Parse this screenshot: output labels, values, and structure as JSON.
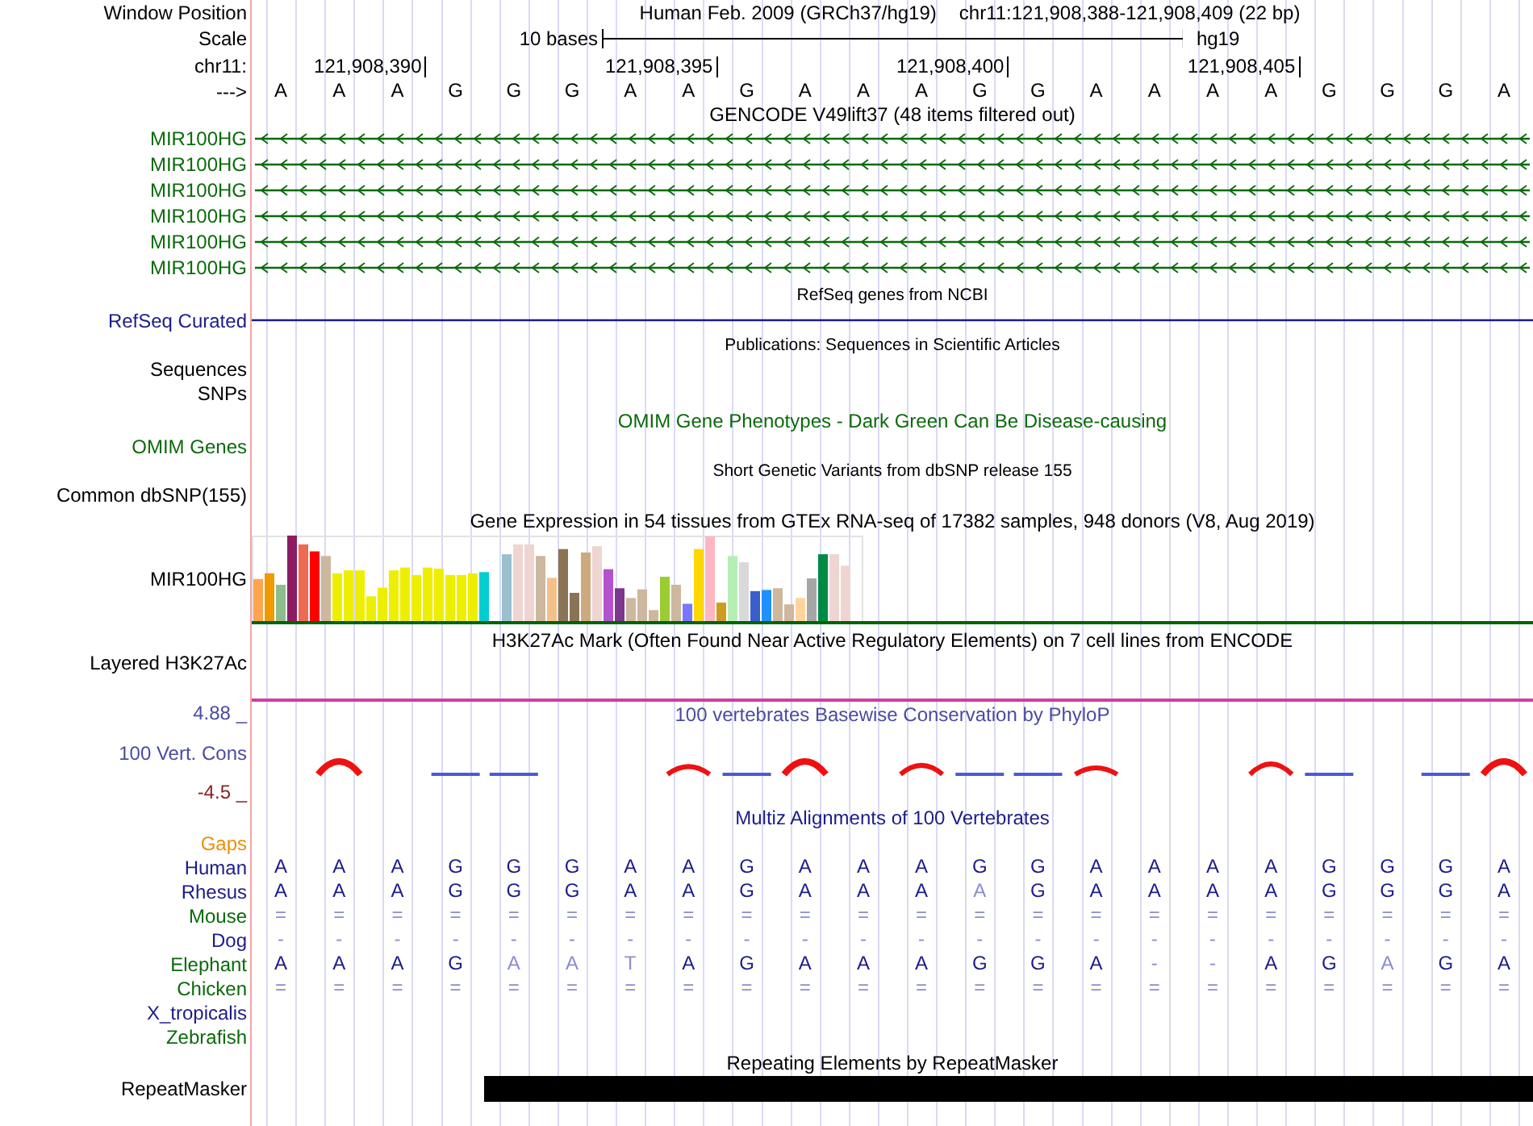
{
  "header": {
    "label": "Window Position",
    "assembly": "Human Feb. 2009 (GRCh37/hg19)",
    "range": "chr11:121,908,388-121,908,409 (22 bp)"
  },
  "scale": {
    "label": "Scale",
    "length": "10 bases",
    "assembly": "hg19"
  },
  "ruler": {
    "label": "chr11:",
    "ticks": [
      "121,908,390",
      "121,908,395",
      "121,908,400",
      "121,908,405"
    ]
  },
  "sequence": {
    "label": "--->",
    "bases": [
      "A",
      "A",
      "A",
      "G",
      "G",
      "G",
      "A",
      "A",
      "G",
      "A",
      "A",
      "A",
      "G",
      "G",
      "A",
      "A",
      "A",
      "A",
      "G",
      "G",
      "G",
      "A"
    ]
  },
  "gencode": {
    "title": "GENCODE V49lift37 (48 items filtered out)",
    "genes": [
      {
        "label": "MIR100HG"
      },
      {
        "label": "MIR100HG"
      },
      {
        "label": "MIR100HG"
      },
      {
        "label": "MIR100HG"
      },
      {
        "label": "MIR100HG"
      },
      {
        "label": "MIR100HG"
      }
    ]
  },
  "refseq": {
    "title": "RefSeq genes from NCBI",
    "label": "RefSeq Curated"
  },
  "publications": {
    "title": "Publications: Sequences in Scientific Articles",
    "label": "Sequences"
  },
  "snps": {
    "label": "SNPs"
  },
  "omim": {
    "title": "OMIM Gene Phenotypes - Dark Green Can Be Disease-causing",
    "label": "OMIM Genes"
  },
  "dbsnp": {
    "title": "Short Genetic Variants from dbSNP release 155",
    "label": "Common dbSNP(155)"
  },
  "gtex": {
    "title": "Gene Expression in 54 tissues from GTEx RNA-seq of 17382 samples, 948 donors (V8, Aug 2019)",
    "label": "MIR100HG"
  },
  "h3k27ac": {
    "title": "H3K27Ac Mark (Often Found Near Active Regulatory Elements) on 7 cell lines from ENCODE",
    "label": "Layered H3K27Ac"
  },
  "phylop": {
    "title": "100 vertebrates Basewise Conservation by PhyloP",
    "label": "100 Vert. Cons",
    "max": "4.88 _",
    "min": "-4.5 _"
  },
  "multiz": {
    "title": "Multiz Alignments of 100 Vertebrates",
    "gaps_label": "Gaps",
    "species": [
      {
        "label": "Human",
        "color": "#1c1c8a",
        "cells": [
          {
            "b": "A",
            "faded": false
          },
          {
            "b": "A",
            "faded": false
          },
          {
            "b": "A",
            "faded": false
          },
          {
            "b": "G",
            "faded": false
          },
          {
            "b": "G",
            "faded": false
          },
          {
            "b": "G",
            "faded": false
          },
          {
            "b": "A",
            "faded": false
          },
          {
            "b": "A",
            "faded": false
          },
          {
            "b": "G",
            "faded": false
          },
          {
            "b": "A",
            "faded": false
          },
          {
            "b": "A",
            "faded": false
          },
          {
            "b": "A",
            "faded": false
          },
          {
            "b": "G",
            "faded": false
          },
          {
            "b": "G",
            "faded": false
          },
          {
            "b": "A",
            "faded": false
          },
          {
            "b": "A",
            "faded": false
          },
          {
            "b": "A",
            "faded": false
          },
          {
            "b": "A",
            "faded": false
          },
          {
            "b": "G",
            "faded": false
          },
          {
            "b": "G",
            "faded": false
          },
          {
            "b": "G",
            "faded": false
          },
          {
            "b": "A",
            "faded": false
          }
        ]
      },
      {
        "label": "Rhesus",
        "color": "#1c1c8a",
        "cells": [
          {
            "b": "A",
            "faded": false
          },
          {
            "b": "A",
            "faded": false
          },
          {
            "b": "A",
            "faded": false
          },
          {
            "b": "G",
            "faded": false
          },
          {
            "b": "G",
            "faded": false
          },
          {
            "b": "G",
            "faded": false
          },
          {
            "b": "A",
            "faded": false
          },
          {
            "b": "A",
            "faded": false
          },
          {
            "b": "G",
            "faded": false
          },
          {
            "b": "A",
            "faded": false
          },
          {
            "b": "A",
            "faded": false
          },
          {
            "b": "A",
            "faded": false
          },
          {
            "b": "A",
            "faded": true
          },
          {
            "b": "G",
            "faded": false
          },
          {
            "b": "A",
            "faded": false
          },
          {
            "b": "A",
            "faded": false
          },
          {
            "b": "A",
            "faded": false
          },
          {
            "b": "A",
            "faded": false
          },
          {
            "b": "G",
            "faded": false
          },
          {
            "b": "G",
            "faded": false
          },
          {
            "b": "G",
            "faded": false
          },
          {
            "b": "A",
            "faded": false
          }
        ]
      },
      {
        "label": "Mouse",
        "color": "#0b6a0b",
        "cells": [
          {
            "b": "=",
            "faded": true
          },
          {
            "b": "=",
            "faded": true
          },
          {
            "b": "=",
            "faded": true
          },
          {
            "b": "=",
            "faded": true
          },
          {
            "b": "=",
            "faded": true
          },
          {
            "b": "=",
            "faded": true
          },
          {
            "b": "=",
            "faded": true
          },
          {
            "b": "=",
            "faded": true
          },
          {
            "b": "=",
            "faded": true
          },
          {
            "b": "=",
            "faded": true
          },
          {
            "b": "=",
            "faded": true
          },
          {
            "b": "=",
            "faded": true
          },
          {
            "b": "=",
            "faded": true
          },
          {
            "b": "=",
            "faded": true
          },
          {
            "b": "=",
            "faded": true
          },
          {
            "b": "=",
            "faded": true
          },
          {
            "b": "=",
            "faded": true
          },
          {
            "b": "=",
            "faded": true
          },
          {
            "b": "=",
            "faded": true
          },
          {
            "b": "=",
            "faded": true
          },
          {
            "b": "=",
            "faded": true
          },
          {
            "b": "=",
            "faded": true
          }
        ]
      },
      {
        "label": "Dog",
        "color": "#1c1c8a",
        "cells": [
          {
            "b": "-",
            "faded": true
          },
          {
            "b": "-",
            "faded": true
          },
          {
            "b": "-",
            "faded": true
          },
          {
            "b": "-",
            "faded": true
          },
          {
            "b": "-",
            "faded": true
          },
          {
            "b": "-",
            "faded": true
          },
          {
            "b": "-",
            "faded": true
          },
          {
            "b": "-",
            "faded": true
          },
          {
            "b": "-",
            "faded": true
          },
          {
            "b": "-",
            "faded": true
          },
          {
            "b": "-",
            "faded": true
          },
          {
            "b": "-",
            "faded": true
          },
          {
            "b": "-",
            "faded": true
          },
          {
            "b": "-",
            "faded": true
          },
          {
            "b": "-",
            "faded": true
          },
          {
            "b": "-",
            "faded": true
          },
          {
            "b": "-",
            "faded": true
          },
          {
            "b": "-",
            "faded": true
          },
          {
            "b": "-",
            "faded": true
          },
          {
            "b": "-",
            "faded": true
          },
          {
            "b": "-",
            "faded": true
          },
          {
            "b": "-",
            "faded": true
          }
        ]
      },
      {
        "label": "Elephant",
        "color": "#0b6a0b",
        "cells": [
          {
            "b": "A",
            "faded": false
          },
          {
            "b": "A",
            "faded": false
          },
          {
            "b": "A",
            "faded": false
          },
          {
            "b": "G",
            "faded": false
          },
          {
            "b": "A",
            "faded": true
          },
          {
            "b": "A",
            "faded": true
          },
          {
            "b": "T",
            "faded": true
          },
          {
            "b": "A",
            "faded": false
          },
          {
            "b": "G",
            "faded": false
          },
          {
            "b": "A",
            "faded": false
          },
          {
            "b": "A",
            "faded": false
          },
          {
            "b": "A",
            "faded": false
          },
          {
            "b": "G",
            "faded": false
          },
          {
            "b": "G",
            "faded": false
          },
          {
            "b": "A",
            "faded": false
          },
          {
            "b": "-",
            "faded": true
          },
          {
            "b": "-",
            "faded": true
          },
          {
            "b": "A",
            "faded": false
          },
          {
            "b": "G",
            "faded": false
          },
          {
            "b": "A",
            "faded": true
          },
          {
            "b": "G",
            "faded": false
          },
          {
            "b": "A",
            "faded": false
          }
        ]
      },
      {
        "label": "Chicken",
        "color": "#0b6a0b",
        "cells": [
          {
            "b": "=",
            "faded": true
          },
          {
            "b": "=",
            "faded": true
          },
          {
            "b": "=",
            "faded": true
          },
          {
            "b": "=",
            "faded": true
          },
          {
            "b": "=",
            "faded": true
          },
          {
            "b": "=",
            "faded": true
          },
          {
            "b": "=",
            "faded": true
          },
          {
            "b": "=",
            "faded": true
          },
          {
            "b": "=",
            "faded": true
          },
          {
            "b": "=",
            "faded": true
          },
          {
            "b": "=",
            "faded": true
          },
          {
            "b": "=",
            "faded": true
          },
          {
            "b": "=",
            "faded": true
          },
          {
            "b": "=",
            "faded": true
          },
          {
            "b": "=",
            "faded": true
          },
          {
            "b": "=",
            "faded": true
          },
          {
            "b": "=",
            "faded": true
          },
          {
            "b": "=",
            "faded": true
          },
          {
            "b": "=",
            "faded": true
          },
          {
            "b": "=",
            "faded": true
          },
          {
            "b": "=",
            "faded": true
          },
          {
            "b": "=",
            "faded": true
          }
        ]
      },
      {
        "label": "X_tropicalis",
        "color": "#1c1c8a"
      },
      {
        "label": "Zebrafish",
        "color": "#0b6a0b"
      }
    ]
  },
  "repeatmasker": {
    "title": "Repeating Elements by RepeatMasker",
    "label": "RepeatMasker"
  }
}
